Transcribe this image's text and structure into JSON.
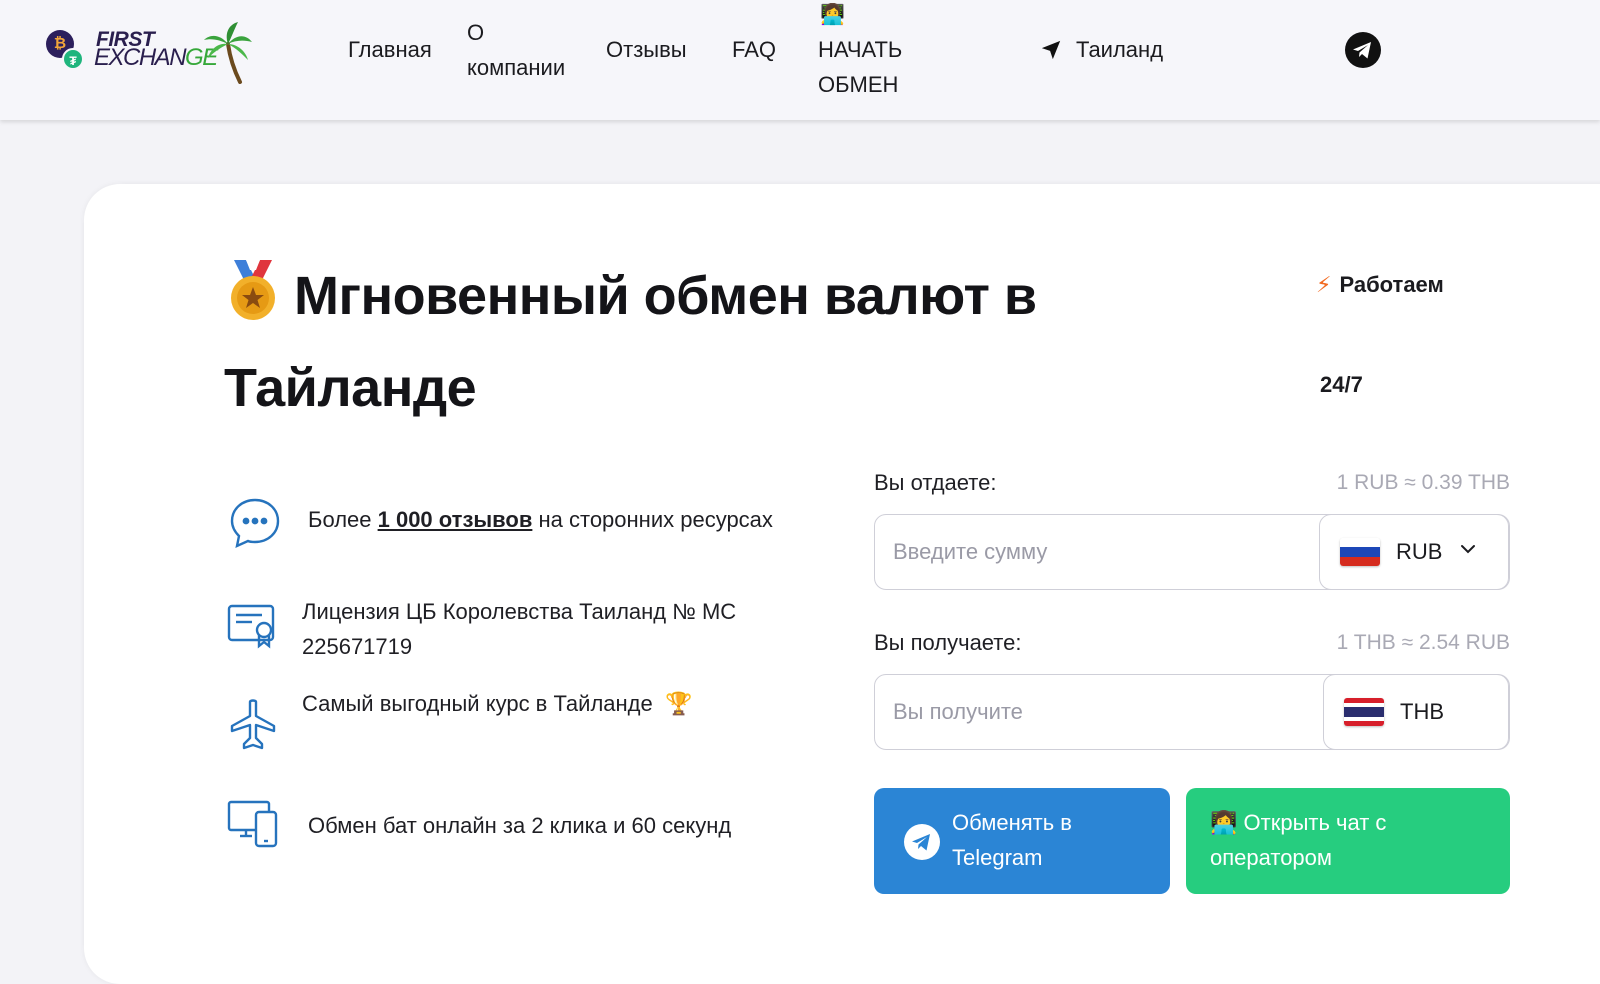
{
  "header": {
    "logo": {
      "first": "FIRST",
      "exchange_main": "EXCHAN",
      "exchange_tail": "GE",
      "btc_symbol": "₿",
      "usdt_symbol": "₮"
    },
    "nav": [
      {
        "label": "Главная"
      },
      {
        "label_line1": "О",
        "label_line2": "компании"
      },
      {
        "label": "Отзывы"
      },
      {
        "label": "FAQ"
      },
      {
        "emoji": "👩‍💻",
        "label_line1": "НАЧАТЬ",
        "label_line2": "ОБМЕН"
      }
    ],
    "location": {
      "icon": "navigation-arrow-icon",
      "label": "Таиланд"
    },
    "telegram_icon": "telegram-icon"
  },
  "hero": {
    "medal_icon": "medal-icon",
    "title_line1": "Мгновенный обмен валют в",
    "title_line2": "Тайланде",
    "status_bolt": "⚡",
    "status_label": "Работаем",
    "status_hours": "24/7"
  },
  "features": [
    {
      "icon": "chat-bubble-icon",
      "text_before": "Более ",
      "link": "1 000 отзывов",
      "text_after": " на сторонних ресурсах"
    },
    {
      "icon": "certificate-icon",
      "line1": "Лицензия ЦБ Королевства Таиланд № МС",
      "line2": "225671719"
    },
    {
      "icon": "airplane-icon",
      "text": "Самый выгодный курс в Тайланде",
      "emoji": "🏆"
    },
    {
      "icon": "devices-icon",
      "text": "Обмен бат онлайн за 2 клика и 60 секунд"
    }
  ],
  "form": {
    "give": {
      "label": "Вы отдаете:",
      "rate": "1 RUB ≈ 0.39 THB",
      "placeholder": "Введите сумму",
      "currency": "RUB"
    },
    "receive": {
      "label": "Вы получаете:",
      "rate": "1 THB ≈ 2.54 RUB",
      "placeholder": "Вы получите",
      "currency": "THB"
    },
    "btn_telegram": {
      "line1": "Обменять в",
      "line2": "Telegram"
    },
    "btn_operator": {
      "emoji": "👩‍💻",
      "line1": " Открыть чат с",
      "line2": "оператором"
    }
  },
  "colors": {
    "accent_blue": "#2b85d5",
    "accent_green": "#26cd7f",
    "icon_blue": "#2673bd"
  }
}
